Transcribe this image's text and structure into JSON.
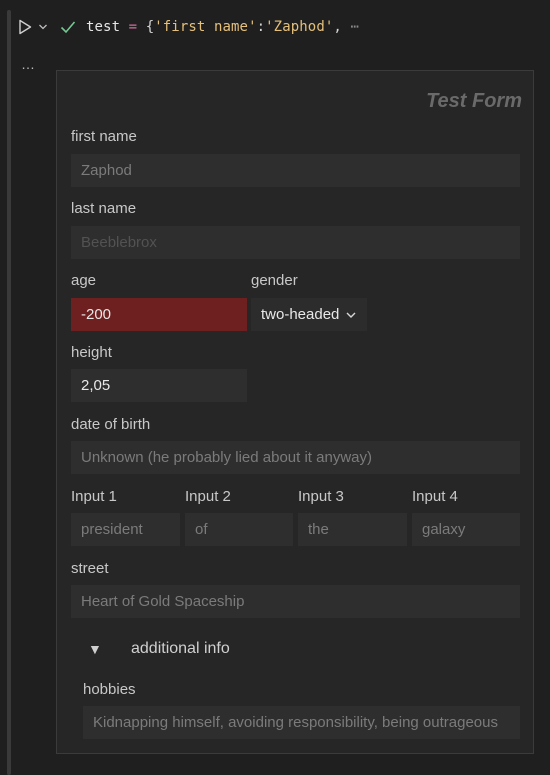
{
  "cell": {
    "code": {
      "var": "test",
      "op": "=",
      "brace": "{",
      "key": "'first name'",
      "colon": ":",
      "value": "'Zaphod'",
      "comma": ",",
      "ellipsis": "⋯"
    },
    "output_ellipsis": "…"
  },
  "form": {
    "title": "Test Form",
    "first_name": {
      "label": "first name",
      "placeholder": "Zaphod"
    },
    "last_name": {
      "label": "last name",
      "placeholder": "Beeblebrox"
    },
    "age": {
      "label": "age",
      "value": "-200"
    },
    "gender": {
      "label": "gender",
      "selected": "two-headed"
    },
    "height": {
      "label": "height",
      "value": "2,05"
    },
    "dob": {
      "label": "date of birth",
      "placeholder": "Unknown (he probably lied about it anyway)"
    },
    "inputs": [
      {
        "label": "Input 1",
        "placeholder": "president"
      },
      {
        "label": "Input 2",
        "placeholder": "of"
      },
      {
        "label": "Input 3",
        "placeholder": "the"
      },
      {
        "label": "Input 4",
        "placeholder": "galaxy"
      }
    ],
    "street": {
      "label": "street",
      "placeholder": "Heart of Gold Spaceship"
    },
    "details": {
      "arrow": "▼",
      "summary": "additional info"
    },
    "hobbies": {
      "label": "hobbies",
      "placeholder": "Kidnapping himself, avoiding responsibility, being outrageous"
    }
  },
  "colors": {
    "background": "#1f1f1f",
    "panel": "#262626",
    "field": "#2e2e2e",
    "error_field": "#6e1f1f",
    "check": "#73c991",
    "string": "#e5c07b",
    "operator": "#d16d9e"
  },
  "icons": {
    "run": "run-icon",
    "chevron": "chevron-down-icon",
    "status": "check-icon",
    "select_arrow": "chevron-down-icon"
  }
}
